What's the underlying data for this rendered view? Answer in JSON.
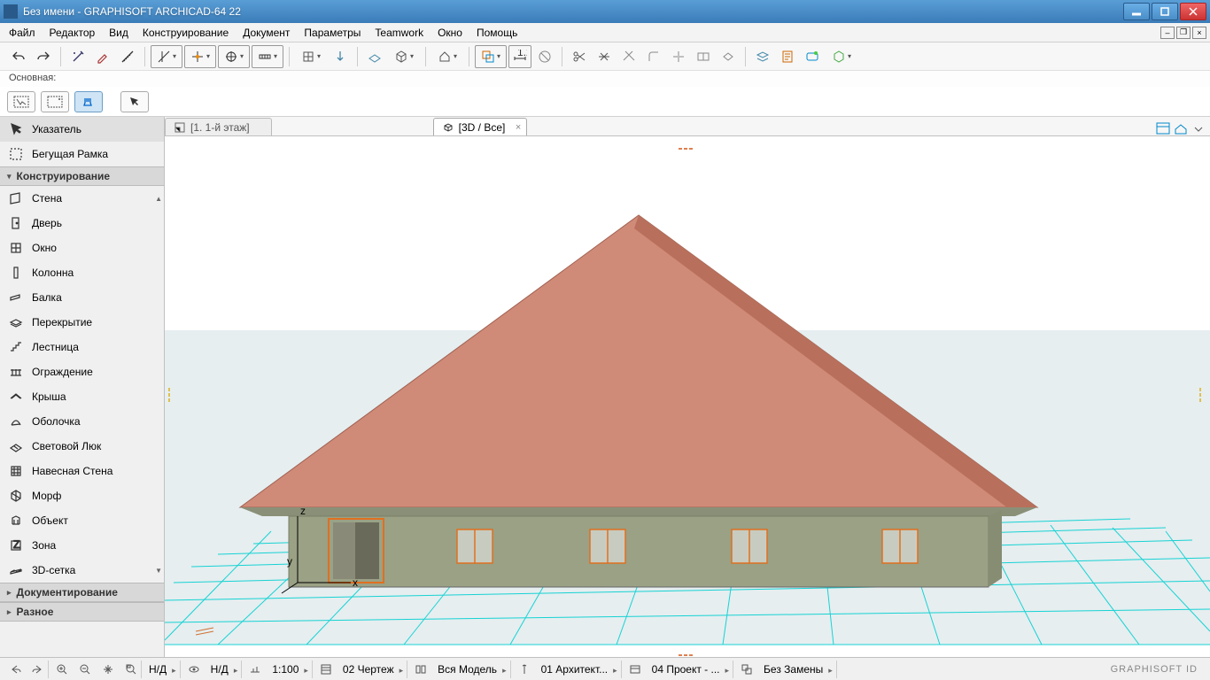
{
  "titlebar": {
    "title": "Без имени - GRAPHISOFT ARCHICAD-64 22"
  },
  "menu": {
    "items": [
      "Файл",
      "Редактор",
      "Вид",
      "Конструирование",
      "Документ",
      "Параметры",
      "Teamwork",
      "Окно",
      "Помощь"
    ]
  },
  "sublabel": "Основная:",
  "sidebar": {
    "pointer": "Указатель",
    "marquee": "Бегущая Рамка",
    "section_design": "Конструирование",
    "tools": [
      "Стена",
      "Дверь",
      "Окно",
      "Колонна",
      "Балка",
      "Перекрытие",
      "Лестница",
      "Ограждение",
      "Крыша",
      "Оболочка",
      "Световой Люк",
      "Навесная Стена",
      "Морф",
      "Объект",
      "Зона",
      "3D-сетка"
    ],
    "section_doc": "Документирование",
    "section_more": "Разное"
  },
  "tabs": {
    "floor": "[1. 1-й этаж]",
    "view3d": "[3D / Все]"
  },
  "status": {
    "nd1": "Н/Д",
    "nd2": "Н/Д",
    "scale": "1:100",
    "drawing": "02 Чертеж",
    "model": "Вся Модель",
    "arch": "01 Архитект...",
    "project": "04 Проект - ...",
    "replace": "Без Замены",
    "brand": "GRAPHISOFT ID"
  }
}
